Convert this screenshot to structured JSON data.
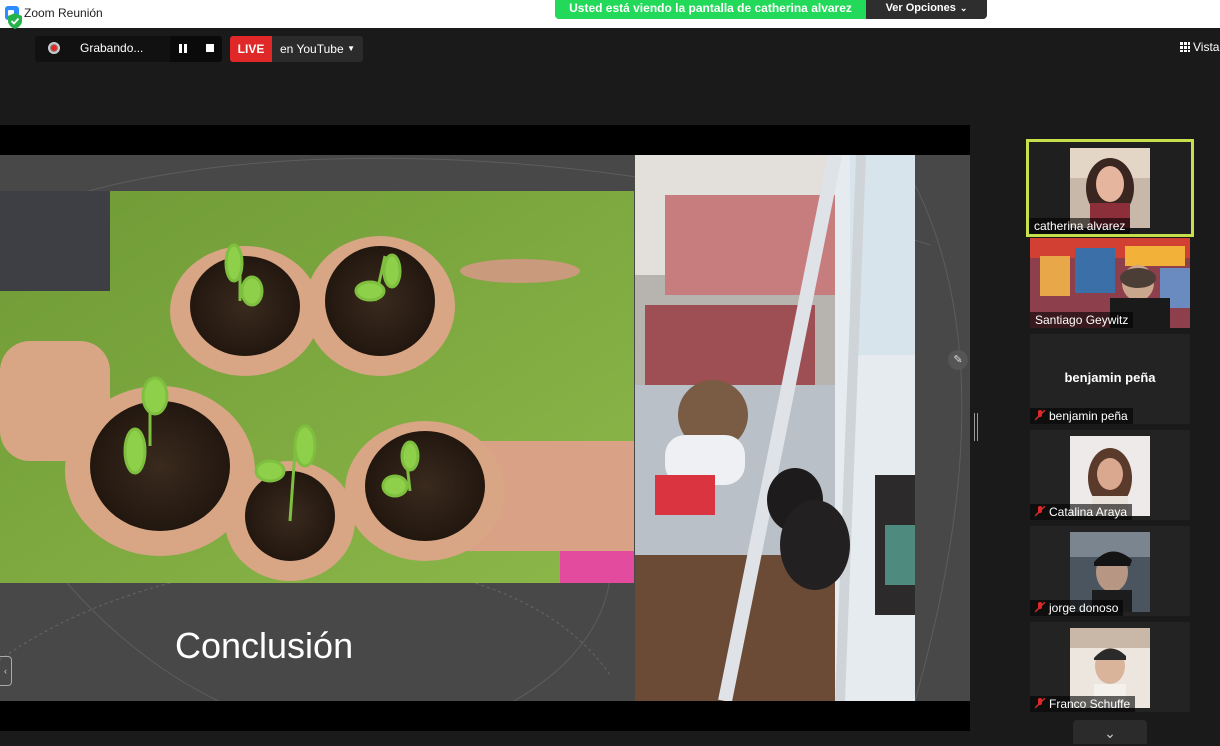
{
  "window": {
    "title": "Zoom Reunión"
  },
  "share_banner": {
    "message": "Usted está viendo la pantalla de catherina alvarez",
    "options_label": "Ver Opciones"
  },
  "recording": {
    "label": "Grabando..."
  },
  "live": {
    "badge": "LIVE",
    "target": "en YouTube"
  },
  "view": {
    "label": "Vista"
  },
  "slide": {
    "title": "Conclusión"
  },
  "participants": [
    {
      "name": "catherina alvarez",
      "active": true,
      "video": true,
      "muted": false
    },
    {
      "name": "Santiago Geywitz",
      "active": false,
      "video": true,
      "muted": false
    },
    {
      "name": "benjamin peña",
      "active": false,
      "video": false,
      "muted": true,
      "display_name": "benjamin peña"
    },
    {
      "name": "Catalina Araya",
      "active": false,
      "video": true,
      "muted": true
    },
    {
      "name": "jorge donoso",
      "active": false,
      "video": true,
      "muted": true
    },
    {
      "name": "Franco Schuffe",
      "active": false,
      "video": true,
      "muted": true
    }
  ],
  "colors": {
    "share_banner": "#23d959",
    "live": "#e02828",
    "active_speaker": "#c6e04b",
    "background": "#1a1a1a"
  },
  "icons": [
    "zoom-app-icon",
    "shield-icon",
    "record-icon",
    "pause-icon",
    "stop-icon",
    "caret-down-icon",
    "grid-icon",
    "chevron-down-icon",
    "pen-icon",
    "muted-mic-icon"
  ]
}
